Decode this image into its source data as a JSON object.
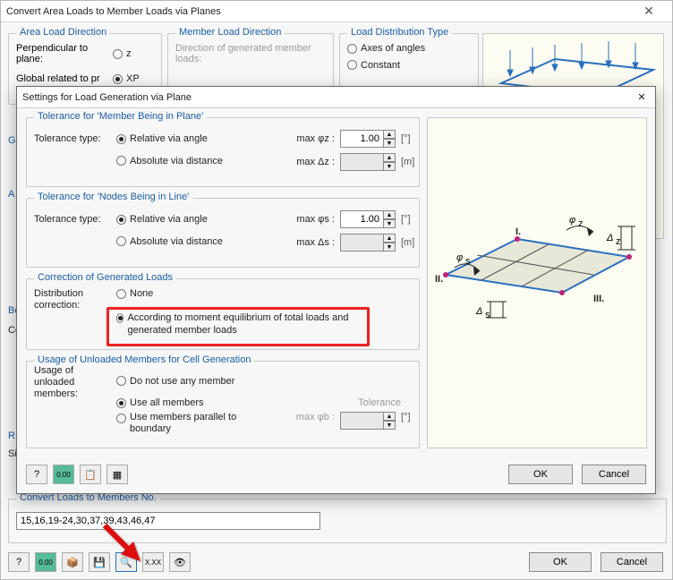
{
  "bgwin": {
    "title": "Convert Area Loads to Member Loads via Planes",
    "area_load_direction": {
      "legend": "Area Load Direction",
      "perp_label": "Perpendicular to plane:",
      "z": "z",
      "global_label": "Global related to pr",
      "xp": "XP"
    },
    "member_load_direction": {
      "legend": "Member Load Direction",
      "text": "Direction of generated member loads:"
    },
    "load_dist": {
      "legend": "Load Distribution Type",
      "axes": "Axes of angles",
      "constant": "Constant"
    },
    "convert": {
      "legend": "Convert Loads to Members No.",
      "value": "15,16,19-24,30,37,39,43,46,47"
    },
    "footer": {
      "ok": "OK",
      "cancel": "Cancel"
    },
    "extra_legends": {
      "truss": "Gl tru",
      "a": "A",
      "b": "Bc",
      "c": "Co",
      "r": "R",
      "s": "Si"
    }
  },
  "modal": {
    "title": "Settings for Load Generation via Plane",
    "tol_plane": {
      "legend": "Tolerance for 'Member Being in Plane'",
      "type_label": "Tolerance type:",
      "rel": "Relative via angle",
      "abs": "Absolute via distance",
      "p_rel": "max φz :",
      "p_abs": "max Δz :",
      "val_rel": "1.00",
      "u_rel": "[°]",
      "u_abs": "[m]"
    },
    "tol_line": {
      "legend": "Tolerance for 'Nodes Being in Line'",
      "type_label": "Tolerance type:",
      "rel": "Relative via angle",
      "abs": "Absolute via distance",
      "p_rel": "max φs :",
      "p_abs": "max Δs :",
      "val_rel": "1.00",
      "u_rel": "[°]",
      "u_abs": "[m]"
    },
    "corr": {
      "legend": "Correction of Generated Loads",
      "label": "Distribution correction:",
      "none": "None",
      "moment": "According to moment equilibrium of total loads and generated member loads"
    },
    "unloaded": {
      "legend": "Usage of Unloaded Members for Cell Generation",
      "label": "Usage of unloaded members:",
      "donot": "Do not use any member",
      "useall": "Use all members",
      "parallel": "Use members parallel to boundary",
      "tol_label": "Tolerance",
      "p": "max φb :",
      "u": "[°]"
    },
    "footer": {
      "ok": "OK",
      "cancel": "Cancel"
    },
    "diagram": {
      "phi_z": "φz",
      "delta_z": "Δz",
      "phi_s": "φs",
      "delta_s": "Δs",
      "I": "I.",
      "II": "II.",
      "III": "III."
    }
  },
  "icons": {
    "help": "?",
    "num": "0.00",
    "pic": "📋",
    "grid": "▦",
    "save": "💾",
    "search": "🔍",
    "xx": "X.XX",
    "eye": "👁",
    "pack": "📦"
  }
}
